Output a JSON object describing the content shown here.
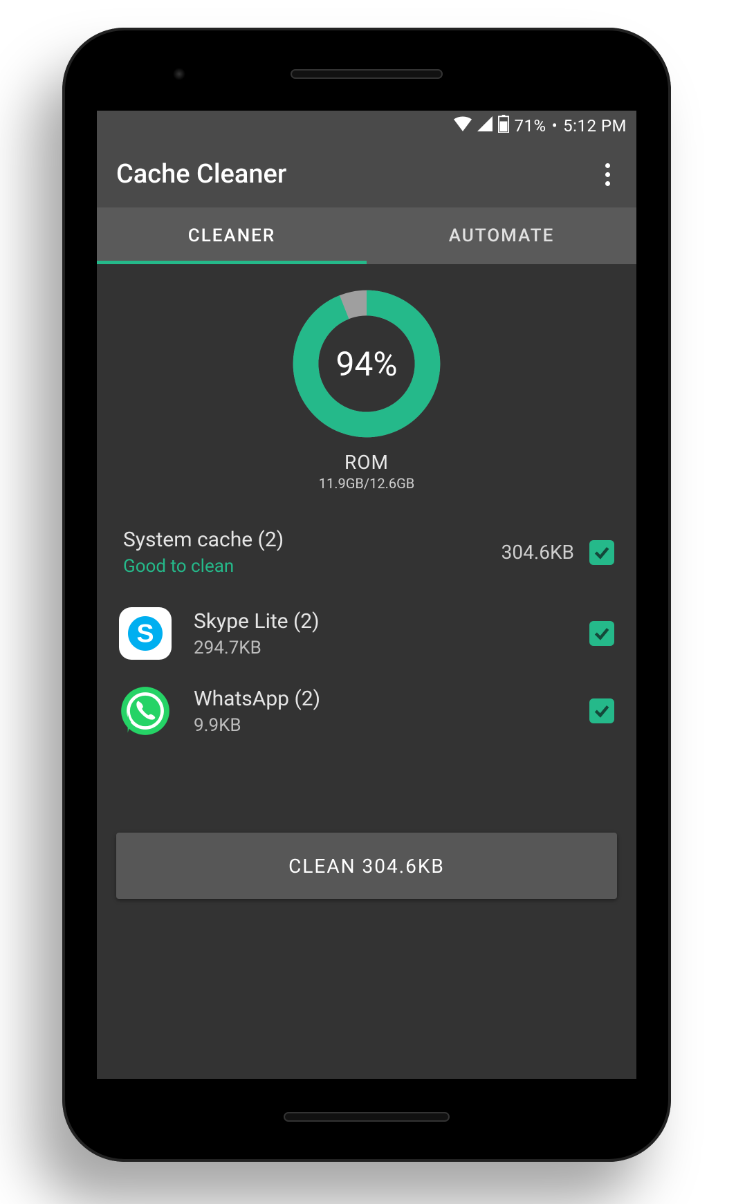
{
  "statusbar": {
    "battery": "71%",
    "time": "5:12 PM"
  },
  "appbar": {
    "title": "Cache Cleaner"
  },
  "tabs": {
    "cleaner": "CLEANER",
    "automate": "AUTOMATE",
    "active": "cleaner"
  },
  "storage": {
    "percent_label": "94%",
    "percent_value": 94,
    "title": "ROM",
    "detail": "11.9GB/12.6GB"
  },
  "system_cache": {
    "title": "System cache (2)",
    "hint": "Good to clean",
    "size": "304.6KB",
    "checked": true
  },
  "apps": [
    {
      "name": "Skype Lite (2)",
      "size": "294.7KB",
      "checked": true,
      "icon": "skype"
    },
    {
      "name": "WhatsApp (2)",
      "size": "9.9KB",
      "checked": true,
      "icon": "whatsapp"
    }
  ],
  "clean_button": "CLEAN 304.6KB",
  "colors": {
    "accent": "#25b98a"
  }
}
